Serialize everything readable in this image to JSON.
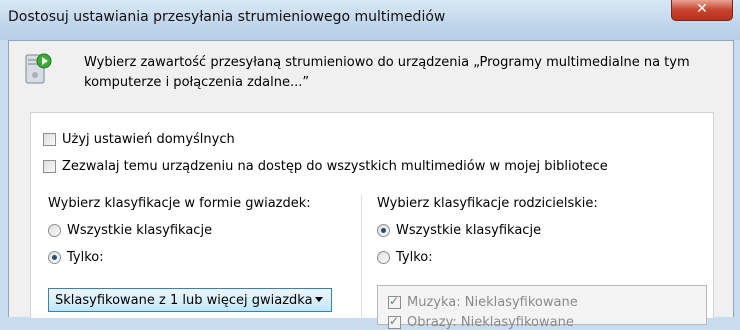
{
  "window": {
    "title": "Dostosuj ustawiania przesyłania strumieniowego multimediów",
    "close_label": "✕"
  },
  "header": {
    "description": "Wybierz zawartość przesyłaną strumieniowo do urządzenia „Programy multimedialne na tym komputerze i połączenia zdalne...”"
  },
  "options": {
    "use_defaults": {
      "label": "Użyj ustawień domyślnych",
      "checked": false
    },
    "allow_all": {
      "label": "Zezwalaj temu urządzeniu na dostęp do wszystkich multimediów w mojej bibliotece",
      "checked": false
    }
  },
  "star_ratings": {
    "heading": "Wybierz klasyfikacje w formie gwiazdek:",
    "all_label": "Wszystkie klasyfikacje",
    "only_label": "Tylko:",
    "selected": "only",
    "dropdown_value": "Sklasyfikowane z 1 lub więcej gwiazdka"
  },
  "parental_ratings": {
    "heading": "Wybierz klasyfikacje rodzicielskie:",
    "all_label": "Wszystkie klasyfikacje",
    "only_label": "Tylko:",
    "selected": "all",
    "list": [
      {
        "label": "Muzyka: Nieklasyfikowane",
        "checked": true
      },
      {
        "label": "Obrazy: Nieklasyfikowane",
        "checked": true
      }
    ]
  },
  "colors": {
    "accent": "#3c7fb1",
    "close_button": "#c8442e"
  },
  "icons": {
    "header_icon": "media-streaming-device-icon"
  }
}
